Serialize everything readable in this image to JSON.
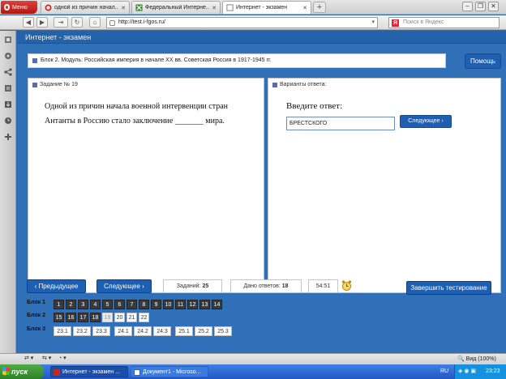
{
  "browser": {
    "menu_label": "Меню",
    "tabs": [
      {
        "title": "одной из причин начал...",
        "active": false
      },
      {
        "title": "Федеральный Интерне...",
        "active": false
      },
      {
        "title": "Интернет - экзамен",
        "active": true
      }
    ],
    "url": "http://test.i-fgos.ru/",
    "search_placeholder": "Поиск в Яндекс",
    "search_engine_letter": "Я",
    "zoom": "Вид (100%)"
  },
  "page": {
    "header": "Интернет - экзамен",
    "block_info": "Блок 2. Модуль: Российская империя в начале XX вв. Советская Россия в 1917-1945 гг.",
    "help_label": "Помощь",
    "question_title": "Задание № 19",
    "question_text": "Одной из причин начала военной интервенции стран Антанты в Россию стало заключение _______ мира.",
    "answers_title": "Варианты ответа:",
    "answer_prompt": "Введите ответ:",
    "answer_value": "БРЕСТСКОГО",
    "next_small_label": "Следующее",
    "prev_label": "Предыдущее",
    "next_label": "Следующее",
    "tasks_label": "Заданий:",
    "tasks_count": "25",
    "answered_label": "Дано ответов:",
    "answered_count": "18",
    "timer": "54:51",
    "finish_label": "Завершить тестирование"
  },
  "blocks": [
    {
      "label": "Блок 1",
      "items": [
        {
          "n": "1",
          "state": "done"
        },
        {
          "n": "2",
          "state": "done"
        },
        {
          "n": "3",
          "state": "done"
        },
        {
          "n": "4",
          "state": "done"
        },
        {
          "n": "5",
          "state": "done"
        },
        {
          "n": "6",
          "state": "done"
        },
        {
          "n": "7",
          "state": "done"
        },
        {
          "n": "8",
          "state": "done"
        },
        {
          "n": "9",
          "state": "done"
        },
        {
          "n": "10",
          "state": "done"
        },
        {
          "n": "11",
          "state": "done"
        },
        {
          "n": "12",
          "state": "done"
        },
        {
          "n": "13",
          "state": "done"
        },
        {
          "n": "14",
          "state": "done"
        }
      ]
    },
    {
      "label": "Блок 2",
      "items": [
        {
          "n": "15",
          "state": "done"
        },
        {
          "n": "16",
          "state": "done"
        },
        {
          "n": "17",
          "state": "done"
        },
        {
          "n": "18",
          "state": "done"
        },
        {
          "n": "19",
          "state": "cur"
        },
        {
          "n": "20",
          "state": "todo"
        },
        {
          "n": "21",
          "state": "todo"
        },
        {
          "n": "22",
          "state": "todo"
        }
      ]
    },
    {
      "label": "Блок 3",
      "items": [
        {
          "n": "23.1",
          "state": "todo"
        },
        {
          "n": "23.2",
          "state": "todo"
        },
        {
          "n": "23.3",
          "state": "todo"
        },
        {
          "n": "24.1",
          "state": "todo"
        },
        {
          "n": "24.2",
          "state": "todo"
        },
        {
          "n": "24.3",
          "state": "todo"
        },
        {
          "n": "25.1",
          "state": "todo"
        },
        {
          "n": "25.2",
          "state": "todo"
        },
        {
          "n": "25.3",
          "state": "todo"
        }
      ]
    }
  ],
  "taskbar": {
    "start_label": "пуск",
    "tasks": [
      {
        "title": "Интернет - экзамен ..."
      },
      {
        "title": "Документ1 - Microso..."
      }
    ],
    "lang": "RU",
    "clock": "23:23"
  },
  "colors": {
    "page_bg": "#2f70b8",
    "button_blue": "#1f5fb1",
    "done_cell": "#3a3a3a",
    "opera_red": "#c8231d"
  }
}
